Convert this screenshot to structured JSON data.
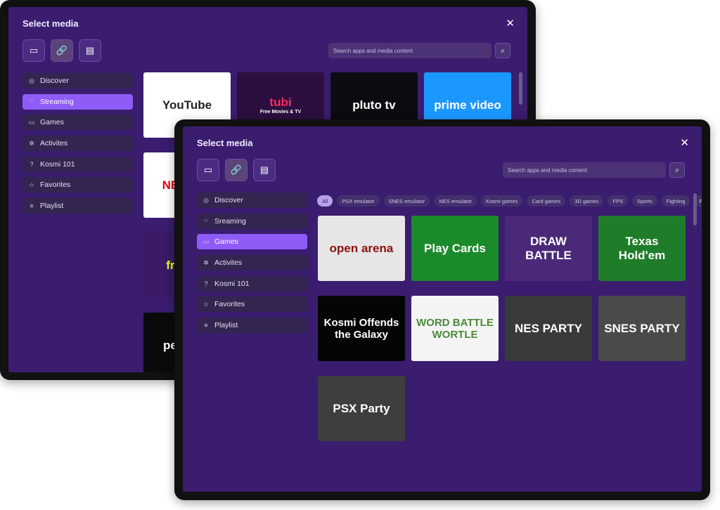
{
  "colors": {
    "window_bg": "#3a1d6f",
    "accent": "#8f5cf7",
    "item_bg": "#33254f"
  },
  "windows": [
    {
      "id": "back",
      "title": "Select media",
      "close_icon": "close-icon",
      "toolbar": [
        {
          "icon": "monitor-icon",
          "glyph": "▭"
        },
        {
          "icon": "link-icon",
          "glyph": "🔗",
          "selected": true
        },
        {
          "icon": "file-icon",
          "glyph": "▤"
        }
      ],
      "search": {
        "placeholder": "Search apps and media content",
        "icon": "search-icon"
      },
      "sidebar": [
        {
          "label": "Discover",
          "icon": "compass-icon",
          "glyph": "◎"
        },
        {
          "label": "Streaming",
          "icon": "apps-icon",
          "glyph": "⁘",
          "active": true
        },
        {
          "label": "Games",
          "icon": "gamepad-icon",
          "glyph": "▭"
        },
        {
          "label": "Activites",
          "icon": "sparkle-icon",
          "glyph": "✲"
        },
        {
          "label": "Kosmi 101",
          "icon": "help-icon",
          "glyph": "?"
        },
        {
          "label": "Favorites",
          "icon": "star-icon",
          "glyph": "☆"
        },
        {
          "label": "Playlist",
          "icon": "playlist-icon",
          "glyph": "≡"
        }
      ],
      "chips": [],
      "tiles": [
        {
          "label": "YouTube",
          "bg": "#ffffff",
          "fg": "#222"
        },
        {
          "label": "tubi",
          "sub": "Free Movies & TV",
          "bg": "#2b0f3e",
          "fg": "#ff2a5f"
        },
        {
          "label": "pluto tv",
          "bg": "#0c0c10",
          "fg": "#fff"
        },
        {
          "label": "prime video",
          "bg": "#1a98ff",
          "fg": "#fff"
        },
        {
          "label": "NETFLIX",
          "bg": "#ffffff",
          "fg": "#e50914"
        },
        {
          "label": "",
          "bg": "#3a1d6f",
          "fg": "#fff"
        },
        {
          "label": "",
          "bg": "#3a1d6f",
          "fg": "#fff"
        },
        {
          "label": "",
          "bg": "#3a1d6f",
          "fg": "#fff"
        },
        {
          "label": "freevee",
          "bg": "#3b1a66",
          "fg": "#e6ff00"
        },
        {
          "label": "",
          "bg": "#3a1d6f",
          "fg": "#fff"
        },
        {
          "label": "",
          "bg": "#3a1d6f",
          "fg": "#fff"
        },
        {
          "label": "",
          "bg": "#3a1d6f",
          "fg": "#fff"
        },
        {
          "label": "peacock",
          "bg": "#0a0a0a",
          "fg": "#fff"
        }
      ]
    },
    {
      "id": "front",
      "title": "Select media",
      "close_icon": "close-icon",
      "toolbar": [
        {
          "icon": "monitor-icon",
          "glyph": "▭"
        },
        {
          "icon": "link-icon",
          "glyph": "🔗",
          "selected": true
        },
        {
          "icon": "file-icon",
          "glyph": "▤"
        }
      ],
      "search": {
        "placeholder": "Search apps and media content",
        "icon": "search-icon"
      },
      "sidebar": [
        {
          "label": "Discover",
          "icon": "compass-icon",
          "glyph": "◎"
        },
        {
          "label": "Sreaming",
          "icon": "apps-icon",
          "glyph": "⁘"
        },
        {
          "label": "Games",
          "icon": "gamepad-icon",
          "glyph": "▭",
          "active": true
        },
        {
          "label": "Activites",
          "icon": "sparkle-icon",
          "glyph": "✲"
        },
        {
          "label": "Kosmi 101",
          "icon": "help-icon",
          "glyph": "?"
        },
        {
          "label": "Favorites",
          "icon": "star-icon",
          "glyph": "☆"
        },
        {
          "label": "Playlist",
          "icon": "playlist-icon",
          "glyph": "≡"
        }
      ],
      "chips": [
        {
          "label": "All",
          "active": true
        },
        {
          "label": "PSX emulator"
        },
        {
          "label": "SNES emulator"
        },
        {
          "label": "NES emulator"
        },
        {
          "label": "Kosmi games"
        },
        {
          "label": "Card games"
        },
        {
          "label": "3D games"
        },
        {
          "label": "FPS"
        },
        {
          "label": "Sports"
        },
        {
          "label": "Fighting"
        },
        {
          "label": "FPS"
        }
      ],
      "tiles": [
        {
          "label": "open arena",
          "bg": "#e6e6e6",
          "fg": "#8b1010"
        },
        {
          "label": "Play Cards",
          "bg": "#1b8a2a",
          "fg": "#fff"
        },
        {
          "label": "DRAW BATTLE",
          "bg": "#4a2a78",
          "fg": "#fff"
        },
        {
          "label": "Texas Hold'em",
          "bg": "#1f7d2a",
          "fg": "#fff"
        },
        {
          "label": "Kosmi Offends the Galaxy",
          "bg": "#050505",
          "fg": "#fff"
        },
        {
          "label": "WORD BATTLE WORTLE",
          "bg": "#f4f4f4",
          "fg": "#4b8a3a"
        },
        {
          "label": "NES PARTY",
          "bg": "#3a3a3a",
          "fg": "#fff"
        },
        {
          "label": "SNES PARTY",
          "bg": "#4a4a4a",
          "fg": "#fff"
        },
        {
          "label": "PSX Party",
          "bg": "#3e3e3e",
          "fg": "#fff"
        }
      ]
    }
  ]
}
